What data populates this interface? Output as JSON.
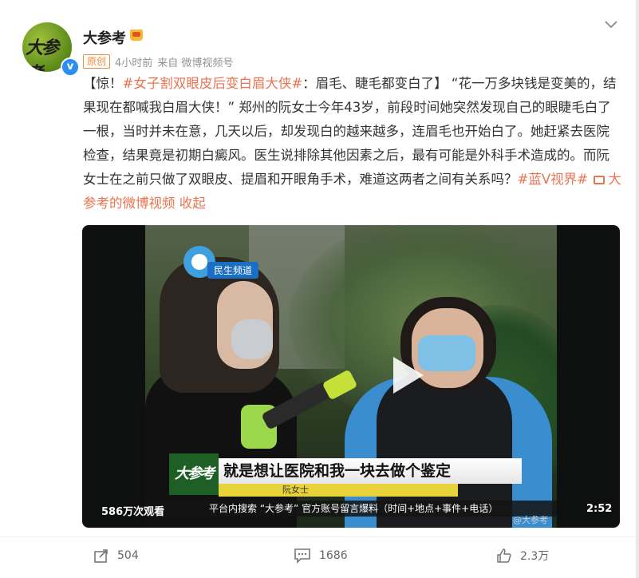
{
  "post": {
    "author": "大参考",
    "tag_original": "原创",
    "time": "4小时前",
    "source": "来自 微博视频号",
    "content": {
      "prefix": "【惊！",
      "topic": "#女子割双眼皮后变白眉大侠#",
      "after_topic": "：眉毛、睫毛都变白了】 “花一万多块钱是变美的，结果现在都喊我白眉大侠！” 郑州的阮女士今年43岁，前段时间她突然发现自己的眼睫毛白了一根，当时并未在意，几天以后，却发现白的越来越多，连眉毛也开始白了。她赶紧去医院检查，结果竟是初期白癜风。医生说排除其他因素之后，最有可能是外科手术造成的。而阮女士在之前只做了双眼皮、提眉和开眼角手术，难道这两者之间有关系吗？",
      "topic2": "#蓝V视界#",
      "video_link": "大参考的微博视频",
      "collapse": "收起"
    }
  },
  "video": {
    "channel_label": "民生频道",
    "show_logo": "大参考",
    "subtitle": "就是想让医院和我一块去做个鉴定",
    "speaker": "阮女士",
    "ticker": "平台内搜索 “大参考” 官方账号留言爆料（时间+地点+事件+电话）",
    "watermark": "@大参考",
    "view_count": "586万次观看",
    "duration": "2:52"
  },
  "actions": {
    "repost_count": "504",
    "comment_count": "1686",
    "like_count": "2.3万"
  },
  "colors": {
    "link": "#eb7350",
    "verified": "#2a8ff0"
  }
}
